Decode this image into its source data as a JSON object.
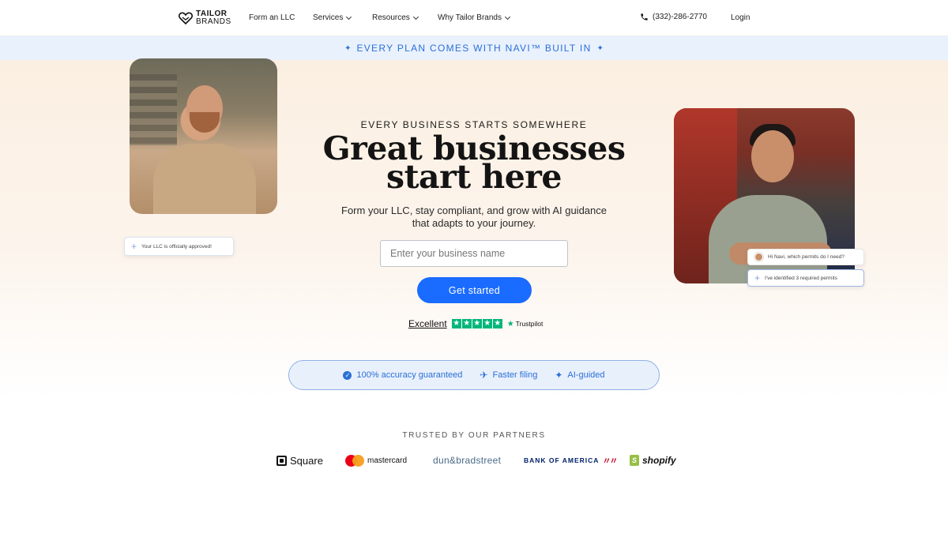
{
  "nav": {
    "logo_line1": "TAILOR",
    "logo_line2": "BRANDS",
    "links": [
      {
        "label": "Form an LLC",
        "has_dropdown": false
      },
      {
        "label": "Services",
        "has_dropdown": true
      },
      {
        "label": "Resources",
        "has_dropdown": true
      },
      {
        "label": "Why Tailor Brands",
        "has_dropdown": true
      }
    ],
    "phone": "(332)-286-2770",
    "login": "Login"
  },
  "banner": {
    "text": "EVERY PLAN COMES WITH NAVI™ BUILT IN",
    "icon": "sparkle-icon"
  },
  "hero": {
    "eyebrow": "EVERY BUSINESS STARTS SOMEWHERE",
    "headline_line1": "Great businesses",
    "headline_line2": "start here",
    "sub_line1": "Form your LLC, stay compliant, and grow with AI guidance",
    "sub_line2": "that adapts to your journey.",
    "input_placeholder": "Enter your business name",
    "cta_label": "Get started",
    "chip_llc": "Your LLC is officially approved!",
    "chip_question": "Hi Navi, which permits do I need?",
    "chip_permits": "I've identified 3 required permits"
  },
  "trustpilot": {
    "rating_label": "Excellent",
    "stars": 5,
    "brand": "Trustpilot"
  },
  "features": [
    {
      "label": "100% accuracy guaranteed",
      "icon": "check-badge-icon"
    },
    {
      "label": "Faster filing",
      "icon": "plane-icon"
    },
    {
      "label": "AI-guided",
      "icon": "sparkle-icon"
    }
  ],
  "partners": {
    "title": "TRUSTED BY OUR PARTNERS",
    "logos": [
      "Square",
      "mastercard",
      "dun&bradstreet",
      "BANK OF AMERICA",
      "shopify"
    ]
  },
  "colors": {
    "accent": "#1a6bff",
    "banner_bg": "#e9f1fd",
    "banner_text": "#2b6fd6",
    "trustpilot_green": "#00b67a"
  }
}
